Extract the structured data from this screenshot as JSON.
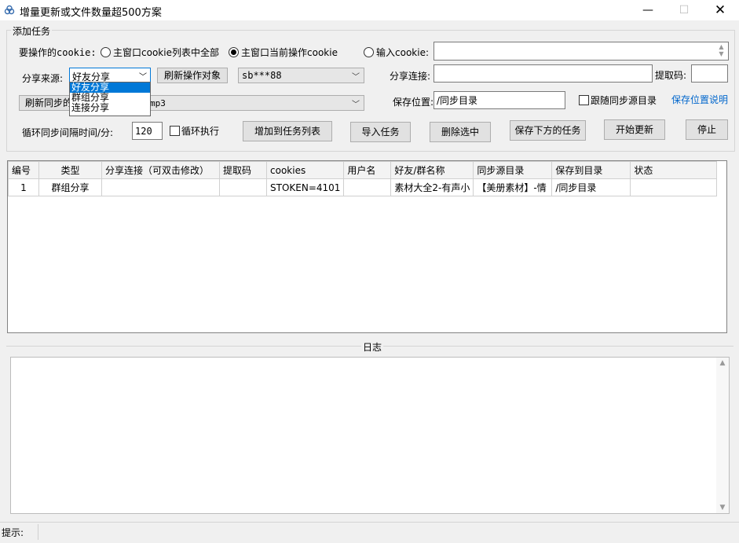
{
  "window": {
    "title": "增量更新或文件数量超500方案",
    "controls": {
      "minimize": "—",
      "maximize": "☐",
      "close": "✕"
    }
  },
  "add_task": {
    "group_title": "添加任务",
    "cookie_label": "要操作的cookie:",
    "radio_all": "主窗口cookie列表中全部",
    "radio_current": "主窗口当前操作cookie",
    "radio_input": "输入cookie:",
    "selected_radio": "current",
    "cookie_input_value": "",
    "share_source_label": "分享来源:",
    "share_source_value": "好友分享",
    "share_source_options": [
      "好友分享",
      "群组分享",
      "连接分享"
    ],
    "refresh_target_button": "刷新操作对象",
    "target_combo_value": "sb***88",
    "share_link_label": "分享连接:",
    "share_link_value": "",
    "extract_code_label": "提取码:",
    "extract_code_value": "",
    "refresh_sync_button": "刷新同步的",
    "sync_combo_value": "mp3",
    "save_location_label": "保存位置:",
    "save_location_value": "/同步目录",
    "follow_sync_label": "跟随同步源目录",
    "save_location_help_link": "保存位置说明",
    "interval_label": "循环同步间隔时间/分:",
    "interval_value": "120",
    "loop_label": "循环执行",
    "add_to_list_button": "增加到任务列表",
    "import_button": "导入任务",
    "delete_button": "删除选中",
    "save_tasks_button": "保存下方的任务",
    "start_button": "开始更新",
    "stop_button": "停止"
  },
  "task_table": {
    "columns": [
      "编号",
      "类型",
      "分享连接（可双击修改）",
      "提取码",
      "cookies",
      "用户名",
      "好友/群名称",
      "同步源目录",
      "保存到目录",
      "状态"
    ],
    "rows": [
      [
        "1",
        "群组分享",
        "",
        "",
        "STOKEN=4101",
        "",
        "素材大全2-有声小",
        "【美册素材】-情",
        "/同步目录",
        ""
      ]
    ]
  },
  "log": {
    "title": "日志",
    "content": ""
  },
  "status": {
    "label": "提示:"
  },
  "colors": {
    "selection": "#0078d7",
    "link": "#0066cc",
    "window_bg": "#f0f0f0"
  }
}
